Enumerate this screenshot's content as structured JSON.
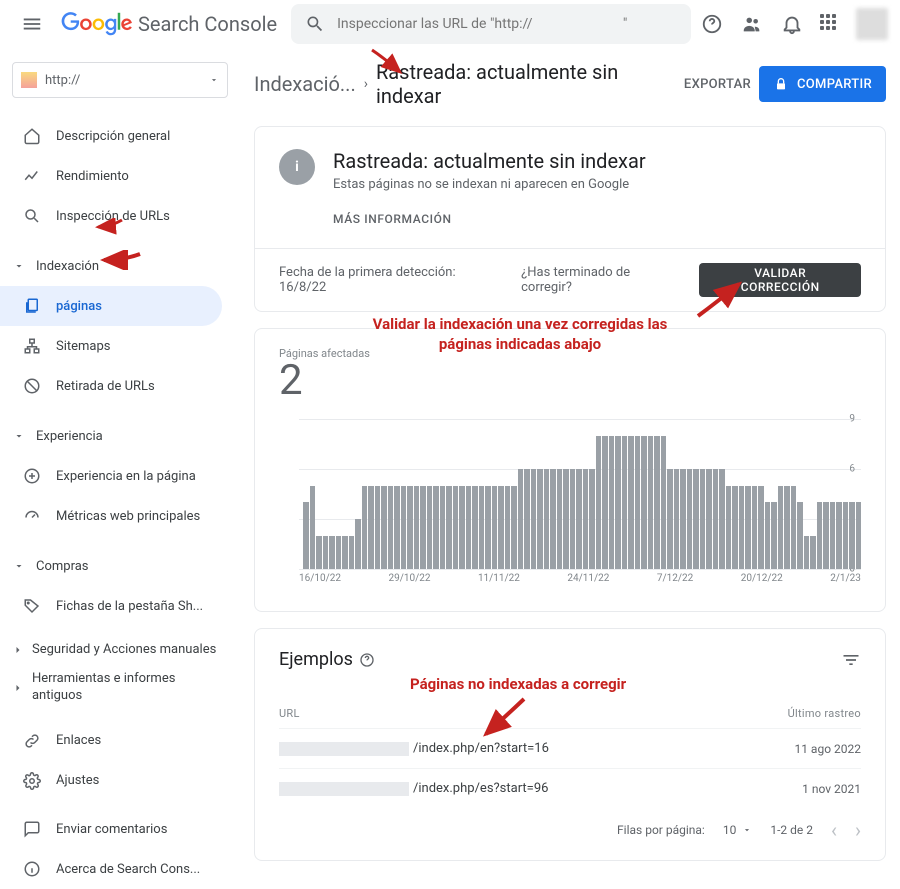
{
  "header": {
    "product_name": "Search Console",
    "search_placeholder": "Inspeccionar las URL de \"http://                          \""
  },
  "sidebar": {
    "property_label": "http://",
    "items": [
      {
        "label": "Descripción general"
      },
      {
        "label": "Rendimiento"
      },
      {
        "label": "Inspección de URLs"
      }
    ],
    "section_indexing": "Indexación",
    "indexing_items": [
      {
        "label": "páginas"
      },
      {
        "label": "Sitemaps"
      },
      {
        "label": "Retirada de URLs"
      }
    ],
    "section_experience": "Experiencia",
    "experience_items": [
      {
        "label": "Experiencia en la página"
      },
      {
        "label": "Métricas web principales"
      }
    ],
    "section_shopping": "Compras",
    "shopping_items": [
      {
        "label": "Fichas de la pestaña Sh..."
      }
    ],
    "section_security": "Seguridad y Acciones manuales",
    "section_legacy": "Herramientas e informes antiguos",
    "link_links": "Enlaces",
    "link_settings": "Ajustes",
    "footer_feedback": "Enviar comentarios",
    "footer_about": "Acerca de Search Cons..."
  },
  "breadcrumb": {
    "parent": "Indexació...",
    "current": "Rastreada: actualmente sin indexar"
  },
  "actions": {
    "export": "EXPORTAR",
    "share": "COMPARTIR"
  },
  "status": {
    "title": "Rastreada: actualmente sin indexar",
    "subtitle": "Estas páginas no se indexan ni aparecen en Google",
    "more_info": "MÁS INFORMACIÓN"
  },
  "validate": {
    "first_detected_label": "Fecha de la primera detección: ",
    "first_detected_date": "16/8/22",
    "question": "¿Has terminado de corregir?",
    "button": "VALIDAR CORRECCIÓN"
  },
  "chart": {
    "label": "Páginas afectadas",
    "value": "2"
  },
  "chart_data": {
    "type": "bar",
    "title": "Páginas afectadas",
    "ylabel": "",
    "ylim": [
      0,
      9
    ],
    "y_ticks": [
      0,
      3,
      6,
      9
    ],
    "x_ticks": [
      "16/10/22",
      "29/10/22",
      "11/11/22",
      "24/11/22",
      "7/12/22",
      "20/12/22",
      "2/1/23"
    ],
    "values": [
      4,
      5,
      2,
      2,
      2,
      2,
      2,
      2,
      3,
      5,
      5,
      5,
      5,
      5,
      5,
      5,
      5,
      5,
      5,
      5,
      5,
      5,
      5,
      5,
      5,
      5,
      5,
      5,
      5,
      5,
      5,
      5,
      5,
      6,
      6,
      6,
      6,
      6,
      6,
      6,
      6,
      6,
      6,
      6,
      6,
      8,
      8,
      8,
      8,
      8,
      8,
      8,
      8,
      8,
      8,
      8,
      6,
      6,
      6,
      6,
      6,
      6,
      6,
      6,
      6,
      5,
      5,
      5,
      5,
      5,
      5,
      4,
      4,
      5,
      5,
      5,
      4,
      2,
      2,
      4,
      4,
      4,
      4,
      4,
      4,
      4
    ]
  },
  "examples": {
    "title": "Ejemplos",
    "col_url": "URL",
    "col_crawl": "Último rastreo",
    "rows": [
      {
        "path": "/index.php/en?start=16",
        "date": "11 ago 2022"
      },
      {
        "path": "/index.php/es?start=96",
        "date": "1 nov 2021"
      }
    ],
    "rows_per_page_label": "Filas por página:",
    "rows_per_page_value": "10",
    "range": "1-2 de 2"
  },
  "annotations": {
    "validate_note": "Validar la indexación una vez corregidas las páginas indicadas abajo",
    "examples_note": "Páginas no indexadas a corregir"
  }
}
